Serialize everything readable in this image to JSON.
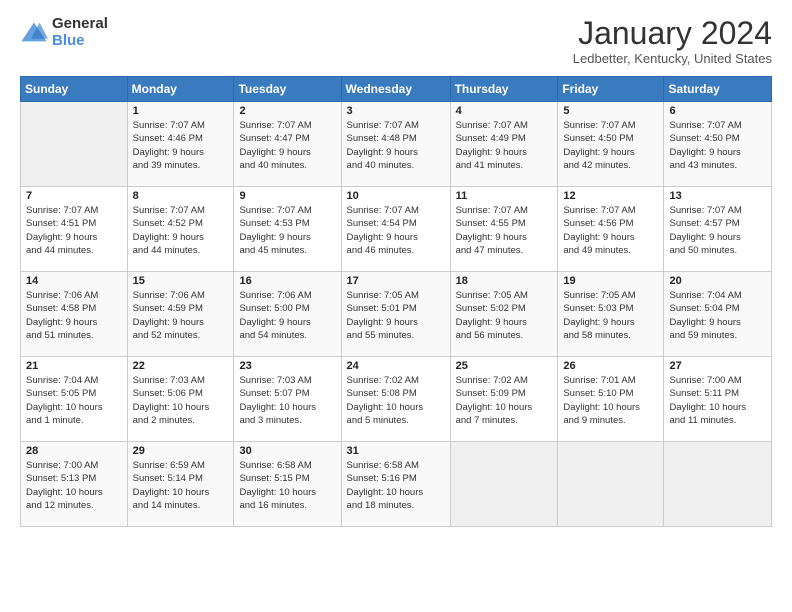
{
  "header": {
    "logo": {
      "general": "General",
      "blue": "Blue"
    },
    "title": "January 2024",
    "location": "Ledbetter, Kentucky, United States"
  },
  "calendar": {
    "days_of_week": [
      "Sunday",
      "Monday",
      "Tuesday",
      "Wednesday",
      "Thursday",
      "Friday",
      "Saturday"
    ],
    "weeks": [
      [
        {
          "day": "",
          "info": ""
        },
        {
          "day": "1",
          "info": "Sunrise: 7:07 AM\nSunset: 4:46 PM\nDaylight: 9 hours\nand 39 minutes."
        },
        {
          "day": "2",
          "info": "Sunrise: 7:07 AM\nSunset: 4:47 PM\nDaylight: 9 hours\nand 40 minutes."
        },
        {
          "day": "3",
          "info": "Sunrise: 7:07 AM\nSunset: 4:48 PM\nDaylight: 9 hours\nand 40 minutes."
        },
        {
          "day": "4",
          "info": "Sunrise: 7:07 AM\nSunset: 4:49 PM\nDaylight: 9 hours\nand 41 minutes."
        },
        {
          "day": "5",
          "info": "Sunrise: 7:07 AM\nSunset: 4:50 PM\nDaylight: 9 hours\nand 42 minutes."
        },
        {
          "day": "6",
          "info": "Sunrise: 7:07 AM\nSunset: 4:50 PM\nDaylight: 9 hours\nand 43 minutes."
        }
      ],
      [
        {
          "day": "7",
          "info": "Sunrise: 7:07 AM\nSunset: 4:51 PM\nDaylight: 9 hours\nand 44 minutes."
        },
        {
          "day": "8",
          "info": "Sunrise: 7:07 AM\nSunset: 4:52 PM\nDaylight: 9 hours\nand 44 minutes."
        },
        {
          "day": "9",
          "info": "Sunrise: 7:07 AM\nSunset: 4:53 PM\nDaylight: 9 hours\nand 45 minutes."
        },
        {
          "day": "10",
          "info": "Sunrise: 7:07 AM\nSunset: 4:54 PM\nDaylight: 9 hours\nand 46 minutes."
        },
        {
          "day": "11",
          "info": "Sunrise: 7:07 AM\nSunset: 4:55 PM\nDaylight: 9 hours\nand 47 minutes."
        },
        {
          "day": "12",
          "info": "Sunrise: 7:07 AM\nSunset: 4:56 PM\nDaylight: 9 hours\nand 49 minutes."
        },
        {
          "day": "13",
          "info": "Sunrise: 7:07 AM\nSunset: 4:57 PM\nDaylight: 9 hours\nand 50 minutes."
        }
      ],
      [
        {
          "day": "14",
          "info": "Sunrise: 7:06 AM\nSunset: 4:58 PM\nDaylight: 9 hours\nand 51 minutes."
        },
        {
          "day": "15",
          "info": "Sunrise: 7:06 AM\nSunset: 4:59 PM\nDaylight: 9 hours\nand 52 minutes."
        },
        {
          "day": "16",
          "info": "Sunrise: 7:06 AM\nSunset: 5:00 PM\nDaylight: 9 hours\nand 54 minutes."
        },
        {
          "day": "17",
          "info": "Sunrise: 7:05 AM\nSunset: 5:01 PM\nDaylight: 9 hours\nand 55 minutes."
        },
        {
          "day": "18",
          "info": "Sunrise: 7:05 AM\nSunset: 5:02 PM\nDaylight: 9 hours\nand 56 minutes."
        },
        {
          "day": "19",
          "info": "Sunrise: 7:05 AM\nSunset: 5:03 PM\nDaylight: 9 hours\nand 58 minutes."
        },
        {
          "day": "20",
          "info": "Sunrise: 7:04 AM\nSunset: 5:04 PM\nDaylight: 9 hours\nand 59 minutes."
        }
      ],
      [
        {
          "day": "21",
          "info": "Sunrise: 7:04 AM\nSunset: 5:05 PM\nDaylight: 10 hours\nand 1 minute."
        },
        {
          "day": "22",
          "info": "Sunrise: 7:03 AM\nSunset: 5:06 PM\nDaylight: 10 hours\nand 2 minutes."
        },
        {
          "day": "23",
          "info": "Sunrise: 7:03 AM\nSunset: 5:07 PM\nDaylight: 10 hours\nand 3 minutes."
        },
        {
          "day": "24",
          "info": "Sunrise: 7:02 AM\nSunset: 5:08 PM\nDaylight: 10 hours\nand 5 minutes."
        },
        {
          "day": "25",
          "info": "Sunrise: 7:02 AM\nSunset: 5:09 PM\nDaylight: 10 hours\nand 7 minutes."
        },
        {
          "day": "26",
          "info": "Sunrise: 7:01 AM\nSunset: 5:10 PM\nDaylight: 10 hours\nand 9 minutes."
        },
        {
          "day": "27",
          "info": "Sunrise: 7:00 AM\nSunset: 5:11 PM\nDaylight: 10 hours\nand 11 minutes."
        }
      ],
      [
        {
          "day": "28",
          "info": "Sunrise: 7:00 AM\nSunset: 5:13 PM\nDaylight: 10 hours\nand 12 minutes."
        },
        {
          "day": "29",
          "info": "Sunrise: 6:59 AM\nSunset: 5:14 PM\nDaylight: 10 hours\nand 14 minutes."
        },
        {
          "day": "30",
          "info": "Sunrise: 6:58 AM\nSunset: 5:15 PM\nDaylight: 10 hours\nand 16 minutes."
        },
        {
          "day": "31",
          "info": "Sunrise: 6:58 AM\nSunset: 5:16 PM\nDaylight: 10 hours\nand 18 minutes."
        },
        {
          "day": "",
          "info": ""
        },
        {
          "day": "",
          "info": ""
        },
        {
          "day": "",
          "info": ""
        }
      ]
    ]
  }
}
